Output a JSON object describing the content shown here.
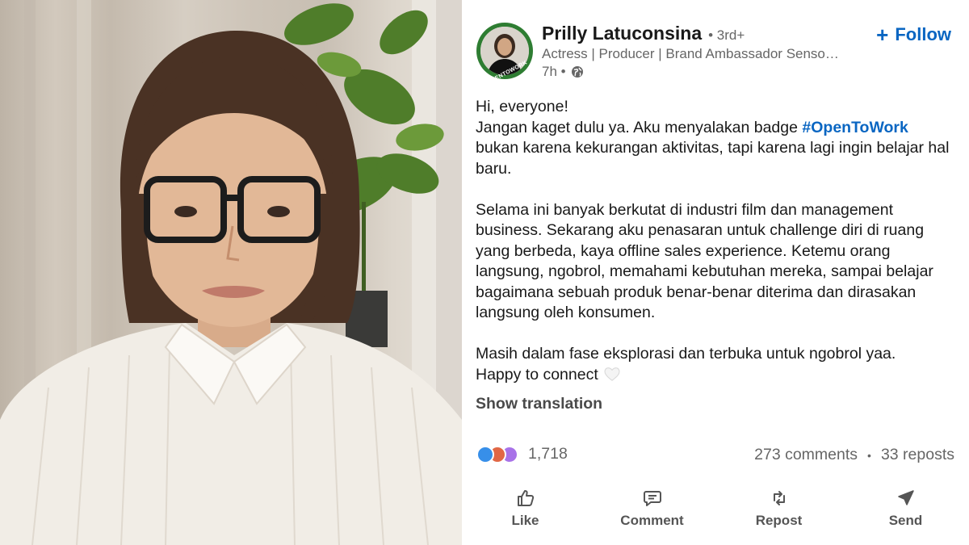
{
  "post": {
    "author": {
      "name": "Prilly Latuconsina",
      "degree": "• 3rd+",
      "headline": "Actress | Producer | Brand Ambassador Senso…",
      "time": "7h •",
      "badge_text": "#OPENTOWORK"
    },
    "follow_label": "Follow",
    "body": {
      "line1": "Hi, everyone!",
      "line2_pre": "Jangan kaget dulu ya. Aku menyalakan badge ",
      "hashtag": "#OpenToWork",
      "line2_post": "bukan karena kekurangan aktivitas, tapi karena lagi ingin belajar hal baru.",
      "para2": "Selama ini banyak berkutat di industri film dan management business. Sekarang aku penasaran untuk challenge diri di ruang yang berbeda, kaya offline sales experience. Ketemu orang langsung, ngobrol, memahami kebutuhan mereka, sampai belajar bagaimana sebuah produk benar-benar diterima dan dirasakan langsung oleh konsumen.",
      "para3a": "Masih dalam fase eksplorasi dan terbuka untuk ngobrol yaa.",
      "para3b": "Happy to connect"
    },
    "show_translation": "Show translation",
    "reaction_count": "1,718",
    "comments": "273 comments",
    "reposts": "33 reposts",
    "actions": [
      {
        "label": "Like",
        "icon": "thumbs-up-icon"
      },
      {
        "label": "Comment",
        "icon": "comment-icon"
      },
      {
        "label": "Repost",
        "icon": "repost-icon"
      },
      {
        "label": "Send",
        "icon": "send-icon"
      }
    ]
  },
  "colors": {
    "accent": "#0a66c2",
    "open_to_work_green": "#2e7d32",
    "text_primary": "#191919",
    "text_secondary": "#666666"
  }
}
